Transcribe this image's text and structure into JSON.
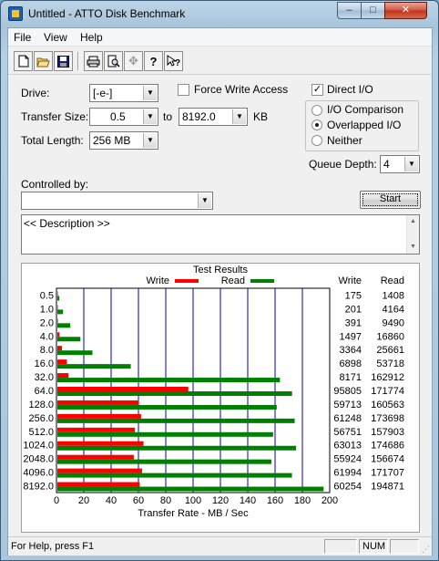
{
  "window": {
    "title": "Untitled - ATTO Disk Benchmark"
  },
  "caption_buttons": {
    "minimize": "–",
    "maximize": "□",
    "close": "✕"
  },
  "menu": [
    "File",
    "View",
    "Help"
  ],
  "toolbar": {
    "icons": [
      "new-icon",
      "open-icon",
      "save-icon",
      "print-icon",
      "print-preview-icon",
      "move-icon",
      "help-icon",
      "context-help-icon"
    ]
  },
  "form": {
    "drive_label": "Drive:",
    "drive_value": "[-e-]",
    "force_write_label": "Force Write Access",
    "force_write_checked": false,
    "direct_io_label": "Direct I/O",
    "direct_io_checked": true,
    "transfer_size_label": "Transfer Size:",
    "transfer_from": "0.5",
    "to_label": "to",
    "transfer_to": "8192.0",
    "kb_label": "KB",
    "total_length_label": "Total Length:",
    "total_length_value": "256 MB",
    "io_options": [
      "I/O Comparison",
      "Overlapped I/O",
      "Neither"
    ],
    "io_selected": "Overlapped I/O",
    "queue_depth_label": "Queue Depth:",
    "queue_depth_value": "4",
    "controlled_by_label": "Controlled by:",
    "controlled_by_value": "",
    "start_label": "Start",
    "description": "<< Description >>"
  },
  "results": {
    "title": "Test Results",
    "legend_write": "Write",
    "legend_read": "Read",
    "col_write": "Write",
    "col_read": "Read",
    "write_color": "#ff0000",
    "read_color": "#008000",
    "rows": [
      {
        "size": "0.5",
        "write": "175",
        "read": "1408"
      },
      {
        "size": "1.0",
        "write": "201",
        "read": "4164"
      },
      {
        "size": "2.0",
        "write": "391",
        "read": "9490"
      },
      {
        "size": "4.0",
        "write": "1497",
        "read": "16860"
      },
      {
        "size": "8.0",
        "write": "3364",
        "read": "25661"
      },
      {
        "size": "16.0",
        "write": "6898",
        "read": "53718"
      },
      {
        "size": "32.0",
        "write": "8171",
        "read": "162912"
      },
      {
        "size": "64.0",
        "write": "95805",
        "read": "171774"
      },
      {
        "size": "128.0",
        "write": "59713",
        "read": "160563"
      },
      {
        "size": "256.0",
        "write": "61248",
        "read": "173698"
      },
      {
        "size": "512.0",
        "write": "56751",
        "read": "157903"
      },
      {
        "size": "1024.0",
        "write": "63013",
        "read": "174686"
      },
      {
        "size": "2048.0",
        "write": "55924",
        "read": "156674"
      },
      {
        "size": "4096.0",
        "write": "61994",
        "read": "171707"
      },
      {
        "size": "8192.0",
        "write": "60254",
        "read": "194871"
      }
    ]
  },
  "chart_data": {
    "type": "bar",
    "orientation": "horizontal",
    "categories": [
      "0.5",
      "1.0",
      "2.0",
      "4.0",
      "8.0",
      "16.0",
      "32.0",
      "64.0",
      "128.0",
      "256.0",
      "512.0",
      "1024.0",
      "2048.0",
      "4096.0",
      "8192.0"
    ],
    "series": [
      {
        "name": "Write",
        "color": "#ff0000",
        "values": [
          0.175,
          0.201,
          0.391,
          1.497,
          3.364,
          6.898,
          8.171,
          95.805,
          59.713,
          61.248,
          56.751,
          63.013,
          55.924,
          61.994,
          60.254
        ]
      },
      {
        "name": "Read",
        "color": "#008000",
        "values": [
          1.408,
          4.164,
          9.49,
          16.86,
          25.661,
          53.718,
          162.912,
          171.774,
          160.563,
          173.698,
          157.903,
          174.686,
          156.674,
          171.707,
          194.871
        ]
      }
    ],
    "x_ticks": [
      "0",
      "20",
      "40",
      "60",
      "80",
      "100",
      "120",
      "140",
      "160",
      "180",
      "200"
    ],
    "xlim": [
      0,
      200
    ],
    "xlabel": "Transfer Rate - MB / Sec",
    "grid": true,
    "legend": "top"
  },
  "status": {
    "help": "For Help, press F1",
    "num": "NUM"
  }
}
